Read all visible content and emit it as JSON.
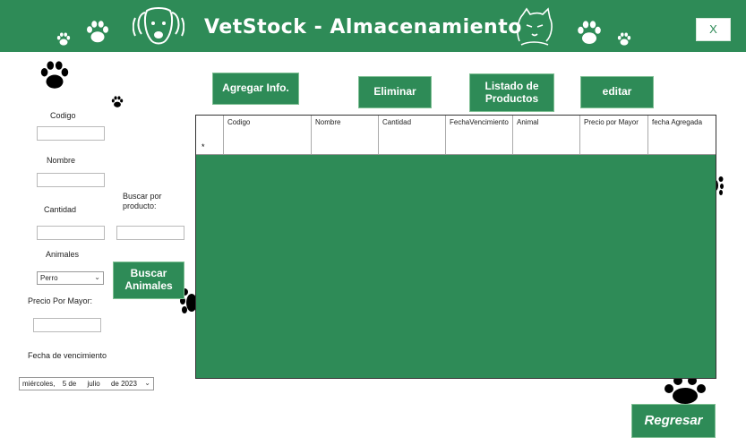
{
  "header": {
    "title": "VetStock - Almacenamiento",
    "close_label": "X"
  },
  "form": {
    "codigo_label": "Codigo",
    "nombre_label": "Nombre",
    "cantidad_label": "Cantidad",
    "animales_label": "Animales",
    "animales_value": "Perro",
    "precio_label": "Precio Por Mayor:",
    "fecha_label": "Fecha de vencimiento",
    "fecha_weekday": "miércoles,",
    "fecha_day": "5 de",
    "fecha_month": "julio",
    "fecha_year": "de 2023",
    "buscar_label": "Buscar por producto:"
  },
  "buttons": {
    "agregar": "Agregar Info.",
    "eliminar": "Eliminar",
    "listado": "Listado de Productos",
    "editar": "editar",
    "buscar_animales": "Buscar Animales",
    "regresar": "Regresar"
  },
  "grid": {
    "columns": [
      "Codigo",
      "Nombre",
      "Cantidad",
      "FechaVencimiento",
      "Animal",
      "Precio por Mayor",
      "fecha Agregada"
    ],
    "new_row_marker": "*"
  },
  "colors": {
    "accent": "#2e8b57",
    "paw": "#000000"
  }
}
